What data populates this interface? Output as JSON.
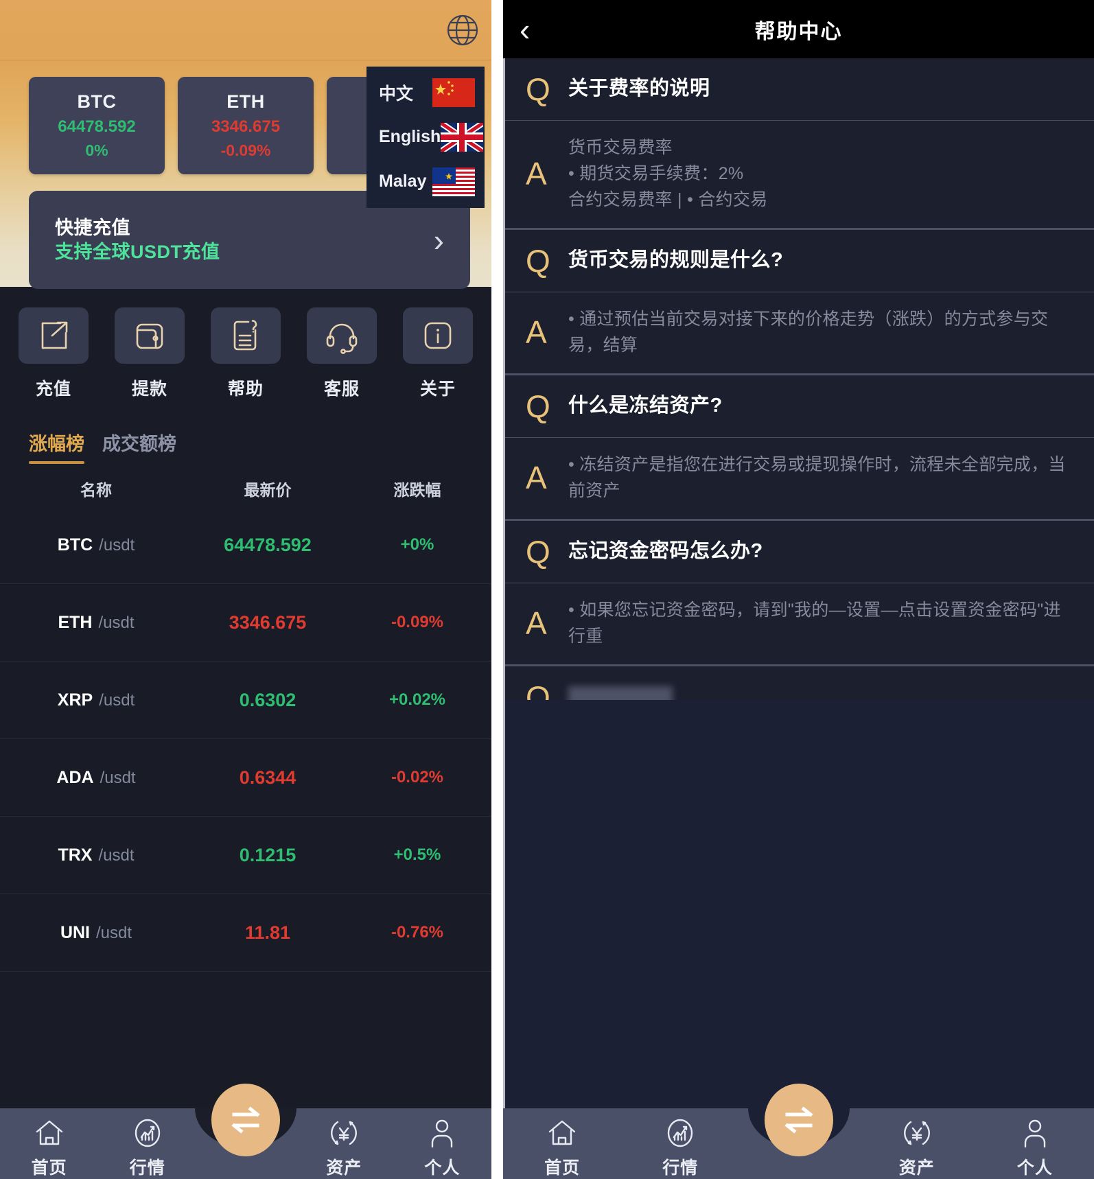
{
  "left": {
    "topbar": {
      "globe_icon": "globe-icon"
    },
    "language_menu": {
      "items": [
        {
          "label": "中文",
          "flag": "cn-flag-icon"
        },
        {
          "label": "English",
          "flag": "uk-flag-icon"
        },
        {
          "label": "Malay",
          "flag": "my-flag-icon"
        }
      ]
    },
    "tickers": [
      {
        "symbol": "BTC",
        "price": "64478.592",
        "change": "0%",
        "dir": "up"
      },
      {
        "symbol": "ETH",
        "price": "3346.675",
        "change": "-0.09%",
        "dir": "down"
      },
      {
        "symbol": "",
        "price": "",
        "change": "",
        "dir": "up"
      }
    ],
    "promo": {
      "title": "快捷充值",
      "subtitle": "支持全球USDT充值",
      "chevron": "›"
    },
    "quick_actions": [
      {
        "label": "充值",
        "icon": "deposit-icon"
      },
      {
        "label": "提款",
        "icon": "wallet-icon"
      },
      {
        "label": "帮助",
        "icon": "help-doc-icon"
      },
      {
        "label": "客服",
        "icon": "headset-icon"
      },
      {
        "label": "关于",
        "icon": "info-icon"
      }
    ],
    "list_tabs": [
      {
        "label": "涨幅榜",
        "active": true
      },
      {
        "label": "成交额榜",
        "active": false
      }
    ],
    "table_headers": {
      "name": "名称",
      "price": "最新价",
      "change": "涨跌幅"
    },
    "markets": [
      {
        "symbol": "BTC",
        "quote": "/usdt",
        "price": "64478.592",
        "change": "+0%",
        "dir": "up"
      },
      {
        "symbol": "ETH",
        "quote": "/usdt",
        "price": "3346.675",
        "change": "-0.09%",
        "dir": "down"
      },
      {
        "symbol": "XRP",
        "quote": "/usdt",
        "price": "0.6302",
        "change": "+0.02%",
        "dir": "up"
      },
      {
        "symbol": "ADA",
        "quote": "/usdt",
        "price": "0.6344",
        "change": "-0.02%",
        "dir": "down"
      },
      {
        "symbol": "TRX",
        "quote": "/usdt",
        "price": "0.1215",
        "change": "+0.5%",
        "dir": "up"
      },
      {
        "symbol": "UNI",
        "quote": "/usdt",
        "price": "11.81",
        "change": "-0.76%",
        "dir": "down"
      }
    ]
  },
  "right": {
    "header": {
      "title": "帮助中心",
      "back_icon": "chevron-left-icon"
    },
    "q_mark": "Q",
    "a_mark": "A",
    "faqs": [
      {
        "question": "关于费率的说明",
        "answer": "货币交易费率\n• 期货交易手续费：2%\n合约交易费率 | • 合约交易",
        "redacted": false
      },
      {
        "question": "货币交易的规则是什么?",
        "answer": "• 通过预估当前交易对接下来的价格走势（涨跌）的方式参与交易，结算",
        "redacted": false
      },
      {
        "question": "什么是冻结资产?",
        "answer": "• 冻结资产是指您在进行交易或提现操作时，流程未全部完成，当前资产",
        "redacted": false
      },
      {
        "question": "忘记资金密码怎么办?",
        "answer": "• 如果您忘记资金密码，请到\"我的—设置—点击设置资金密码\"进行重",
        "redacted": false
      },
      {
        "question": "",
        "answer": "",
        "redacted": true
      }
    ]
  },
  "bottom_nav": {
    "items": [
      {
        "label": "首页",
        "icon": "home-icon"
      },
      {
        "label": "行情",
        "icon": "market-chart-icon"
      },
      {
        "label": "资产",
        "icon": "assets-yen-icon"
      },
      {
        "label": "个人",
        "icon": "profile-person-icon"
      }
    ],
    "fab": {
      "icon": "exchange-swap-icon"
    }
  },
  "colors": {
    "accent_gold": "#e0a94f",
    "up_green": "#2fbd72",
    "down_red": "#e03b30",
    "promo_green": "#4de39b",
    "nav_bg": "#4b5069",
    "fab_bg": "#e6b985"
  }
}
